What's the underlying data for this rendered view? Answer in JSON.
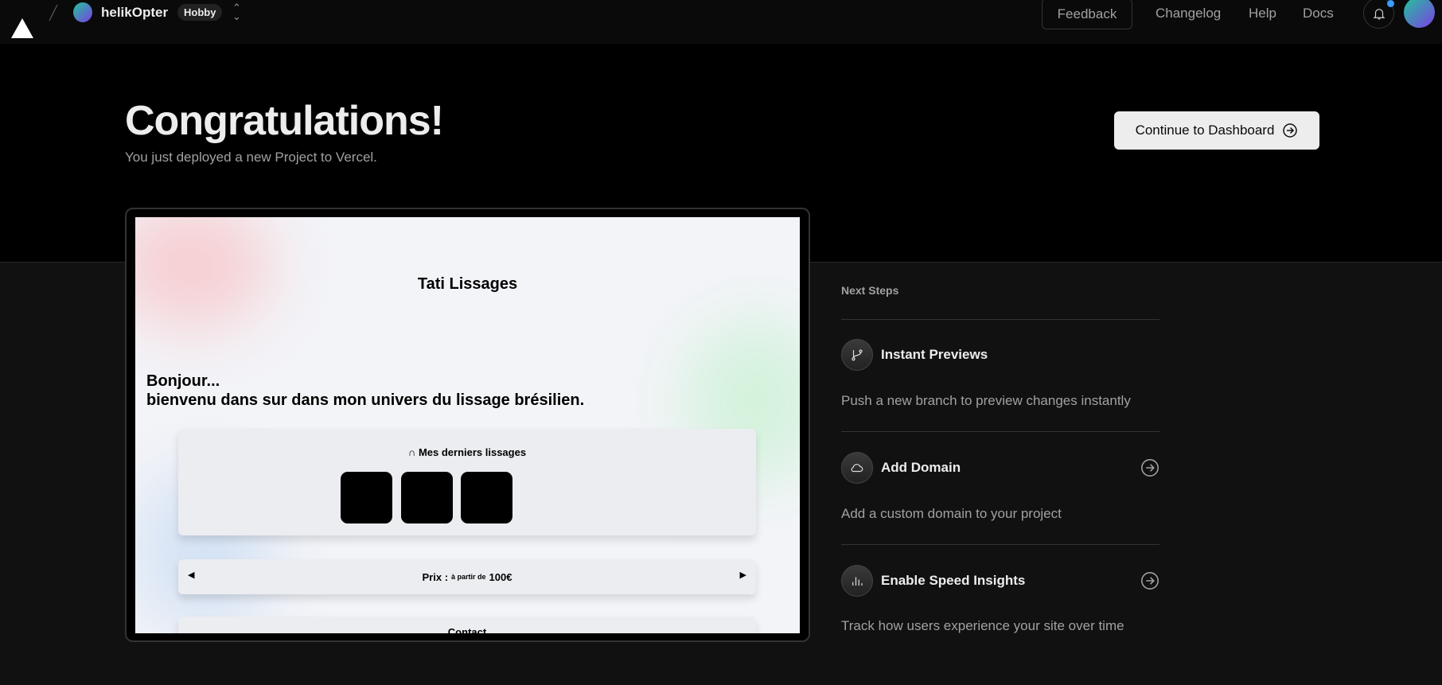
{
  "header": {
    "team": "helikOpter",
    "plan": "Hobby",
    "feedback": "Feedback",
    "changelog": "Changelog",
    "help": "Help",
    "docs": "Docs"
  },
  "hero": {
    "title": "Congratulations!",
    "subtitle": "You just deployed a new Project to Vercel.",
    "cta": "Continue to Dashboard"
  },
  "preview": {
    "site_title": "Tati Lissages",
    "greeting": "Bonjour...",
    "welcome": "bienvenu dans sur dans mon univers du lissage brésilien.",
    "gallery_title": "Mes derniers lissages",
    "price_label": "Prix :",
    "price_small": "à partir de",
    "price_value": "100€",
    "contact": "Contact"
  },
  "next_steps": {
    "heading": "Next Steps",
    "items": [
      {
        "label": "Instant Previews",
        "icon": "git-branch-icon",
        "desc": "Push a new branch to preview changes instantly"
      },
      {
        "label": "Add Domain",
        "icon": "cloud-icon",
        "desc": "Add a custom domain to your project"
      },
      {
        "label": "Enable Speed Insights",
        "icon": "bar-chart-icon",
        "desc": "Track how users experience your site over time"
      }
    ]
  }
}
